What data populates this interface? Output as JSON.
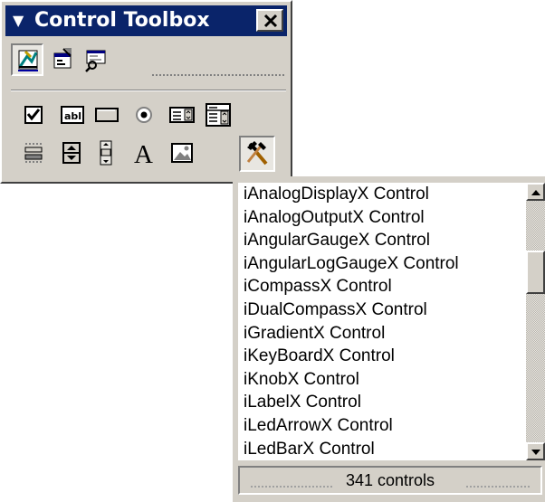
{
  "toolbox": {
    "title": "Control Toolbox",
    "title_arrow": "▼",
    "close_glyph": "✕",
    "row1": [
      "design-mode-icon",
      "properties-icon",
      "view-code-icon"
    ],
    "row2": [
      "checkbox-icon",
      "textbox-icon",
      "command-button-icon",
      "option-button-icon",
      "listbox-icon",
      "combobox-icon"
    ],
    "row3": [
      "toggle-button-icon",
      "spin-button-icon",
      "scrollbar-icon",
      "label-icon",
      "image-icon",
      "more-controls-icon"
    ],
    "label_glyph": "A",
    "textbox_glyph": "abl"
  },
  "more_controls_list": {
    "items": [
      "iAnalogDisplayX Control",
      "iAnalogOutputX Control",
      "iAngularGaugeX Control",
      "iAngularLogGaugeX Control",
      "iCompassX Control",
      "iDualCompassX Control",
      "iGradientX Control",
      "iKeyBoardX Control",
      "iKnobX Control",
      "iLabelX Control",
      "iLedArrowX Control",
      "iLedBarX Control"
    ],
    "status": "341 controls"
  },
  "colors": {
    "titlebar": "#0a246a",
    "face": "#d4d0c8"
  }
}
